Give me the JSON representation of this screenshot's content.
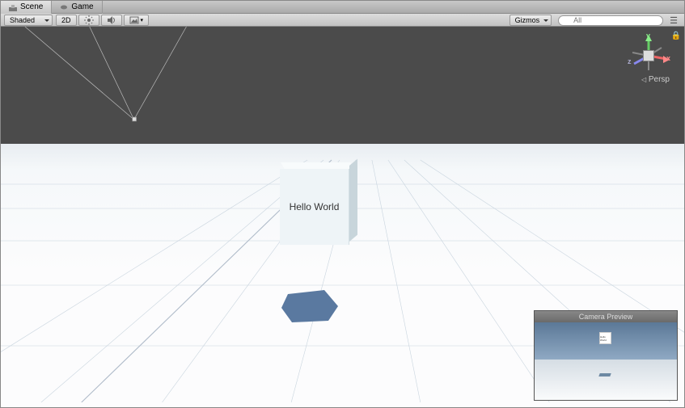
{
  "tabs": {
    "scene": "Scene",
    "game": "Game"
  },
  "toolbar": {
    "shading_mode": "Shaded",
    "mode_2d": "2D",
    "gizmos_label": "Gizmos",
    "search_placeholder": "All"
  },
  "gizmo": {
    "x": "x",
    "y": "y",
    "z": "z",
    "persp": "Persp"
  },
  "scene_objects": {
    "cube_text": "Hello World"
  },
  "camera_preview": {
    "title": "Camera Preview",
    "cube_text": "Hello World"
  }
}
